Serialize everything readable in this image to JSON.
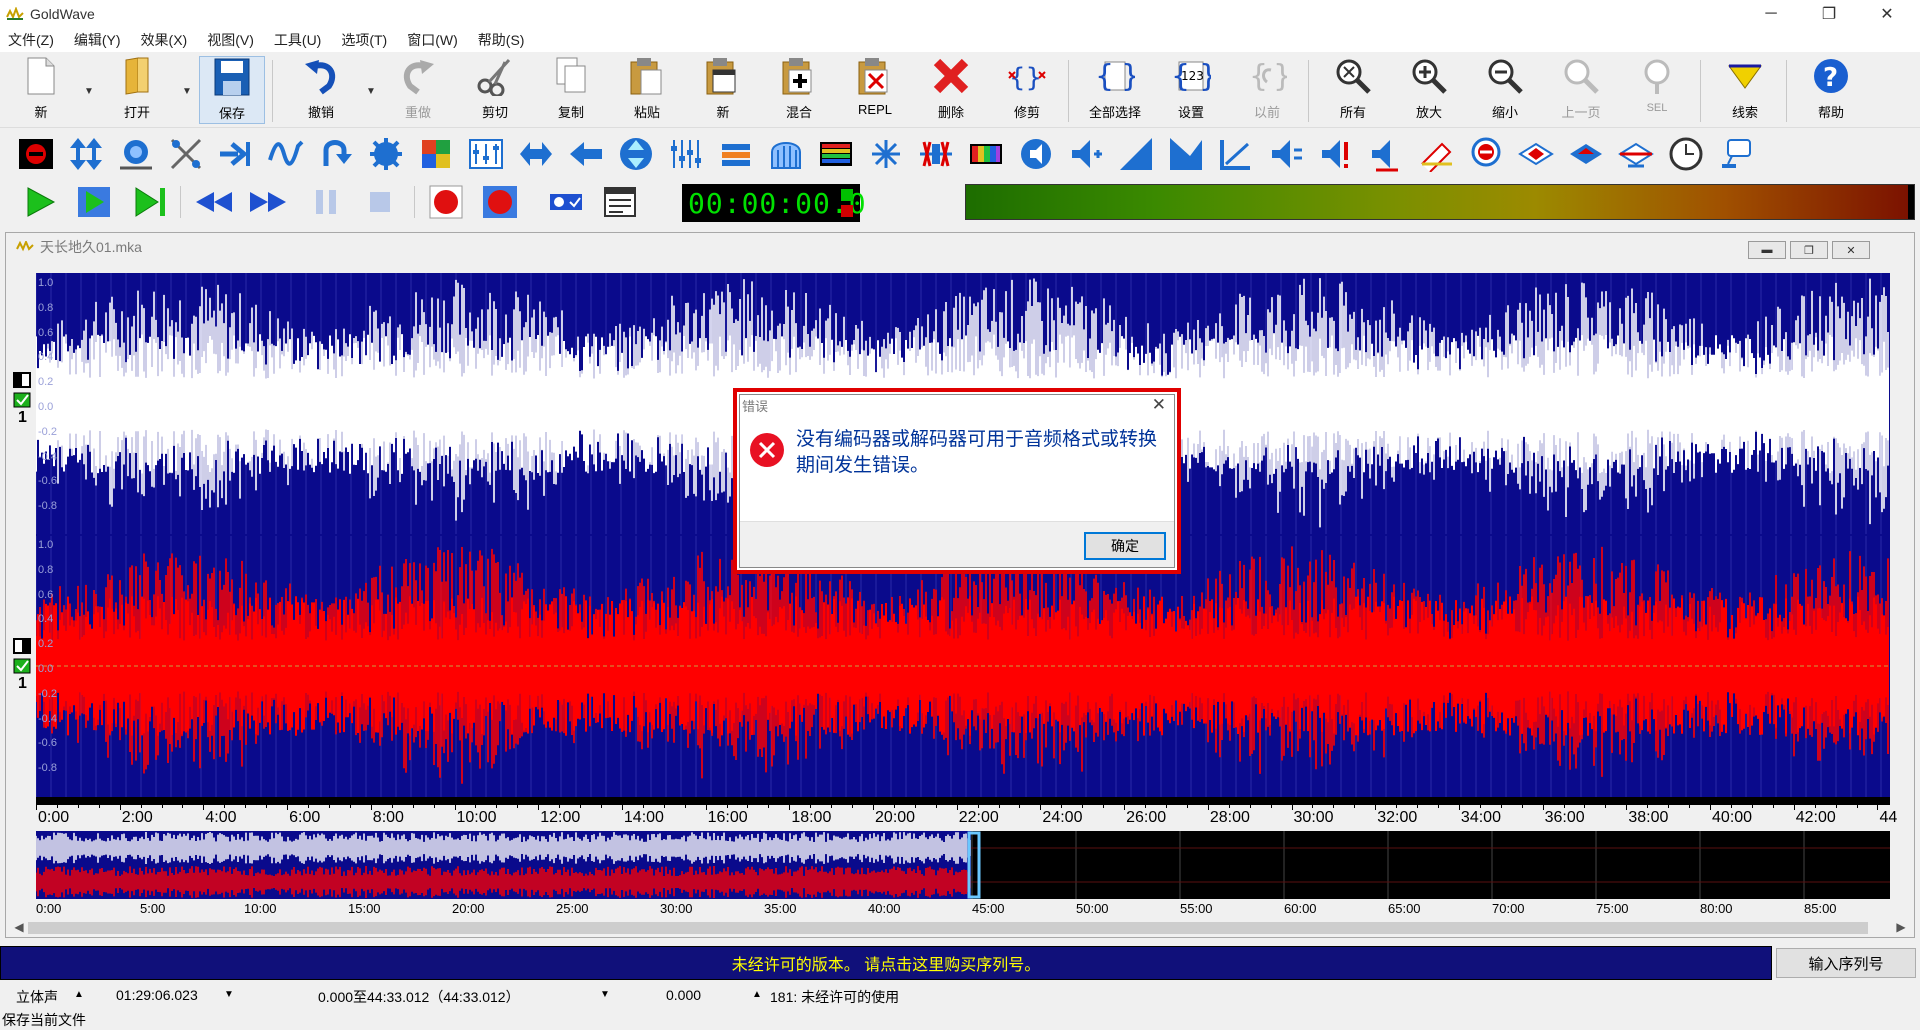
{
  "window": {
    "title": "GoldWave",
    "minimize_glyph": "─",
    "restore_glyph": "❐",
    "close_glyph": "✕"
  },
  "menu": [
    "文件(Z)",
    "编辑(Y)",
    "效果(X)",
    "视图(V)",
    "工具(U)",
    "选项(T)",
    "窗口(W)",
    "帮助(S)"
  ],
  "toolbar": {
    "buttons": [
      {
        "name": "new-file",
        "label": "新",
        "icon": "new-doc-icon"
      },
      {
        "name": "open",
        "label": "打开",
        "icon": "open-folder-icon"
      },
      {
        "name": "save",
        "label": "保存",
        "icon": "save-disk-icon",
        "active": true
      },
      {
        "name": "undo",
        "label": "撤销",
        "icon": "undo-icon"
      },
      {
        "name": "redo",
        "label": "重做",
        "icon": "redo-icon",
        "disabled": true
      },
      {
        "name": "cut",
        "label": "剪切",
        "icon": "scissors-icon"
      },
      {
        "name": "copy",
        "label": "复制",
        "icon": "copy-icon"
      },
      {
        "name": "paste",
        "label": "粘贴",
        "icon": "paste-icon"
      },
      {
        "name": "paste-new",
        "label": "新",
        "icon": "paste-new-icon"
      },
      {
        "name": "mix",
        "label": "混合",
        "icon": "mix-icon"
      },
      {
        "name": "replace",
        "label": "REPL",
        "icon": "replace-icon"
      },
      {
        "name": "delete",
        "label": "删除",
        "icon": "delete-x-icon"
      },
      {
        "name": "trim",
        "label": "修剪",
        "icon": "trim-icon"
      },
      {
        "name": "select-all",
        "label": "全部选择",
        "icon": "select-all-icon"
      },
      {
        "name": "set",
        "label": "设置",
        "icon": "set-123-icon"
      },
      {
        "name": "previous",
        "label": "以前",
        "icon": "previous-icon",
        "disabled": true
      },
      {
        "name": "zoom-all",
        "label": "所有",
        "icon": "zoom-all-icon"
      },
      {
        "name": "zoom-in",
        "label": "放大",
        "icon": "zoom-in-icon"
      },
      {
        "name": "zoom-out",
        "label": "缩小",
        "icon": "zoom-out-icon"
      },
      {
        "name": "prev-page",
        "label": "上一页",
        "icon": "prev-page-icon",
        "disabled": true
      },
      {
        "name": "sel",
        "label": "SEL",
        "icon": "zoom-sel-icon",
        "disabled": true
      },
      {
        "name": "cue",
        "label": "线索",
        "icon": "cue-triangle-icon"
      },
      {
        "name": "help",
        "label": "帮助",
        "icon": "help-icon"
      }
    ]
  },
  "time_display": "00:00:00.0",
  "document": {
    "title": "天长地久01.mka",
    "ch1_scale": [
      "1.0",
      "0.8",
      "0.6",
      "0.4",
      "0.2",
      "0.0",
      "-0.2",
      "-0.4",
      "-0.6",
      "-0.8"
    ],
    "ch2_scale": [
      "1.0",
      "0.8",
      "0.6",
      "0.4",
      "0.2",
      "0.0",
      "-0.2",
      "-0.4",
      "-0.6",
      "-0.8"
    ],
    "channel_number": "1",
    "timeline": [
      "0:00",
      "2:00",
      "4:00",
      "6:00",
      "8:00",
      "10:00",
      "12:00",
      "14:00",
      "16:00",
      "18:00",
      "20:00",
      "22:00",
      "24:00",
      "26:00",
      "28:00",
      "30:00",
      "32:00",
      "34:00",
      "36:00",
      "38:00",
      "40:00",
      "42:00",
      "44"
    ],
    "overview_timeline": [
      "0:00",
      "5:00",
      "10:00",
      "15:00",
      "20:00",
      "25:00",
      "30:00",
      "35:00",
      "40:00",
      "45:00",
      "50:00",
      "55:00",
      "60:00",
      "65:00",
      "70:00",
      "75:00",
      "80:00",
      "85:00"
    ]
  },
  "dialog": {
    "title": "错误",
    "message": "没有编码器或解码器可用于音频格式或转换期间发生错误。",
    "ok_label": "确定",
    "close_glyph": "✕"
  },
  "banner": {
    "text": "未经许可的版本。 请点击这里购买序列号。",
    "serial_button": "输入序列号"
  },
  "status": {
    "channels": "立体声",
    "length": "01:29:06.023",
    "selection": "0.000至44:33.012（44:33.012）",
    "position": "0.000",
    "license": "181: 未经许可的使用",
    "message": "保存当前文件"
  },
  "colors": {
    "wave_bg": "#0a0a8c",
    "left_channel": "#ffffff",
    "right_channel": "#ff0000",
    "dialog_border": "#e00000",
    "banner_text": "#ffff00"
  }
}
